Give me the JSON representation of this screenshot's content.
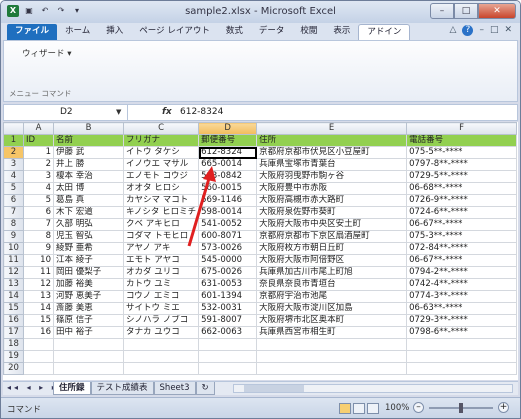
{
  "window": {
    "title": "sample2.xlsx - Microsoft Excel",
    "qat": [
      "▣",
      "↶",
      "↷",
      "▾"
    ],
    "buttons": {
      "minimize": "–",
      "maximize": "□",
      "close": "✕"
    }
  },
  "ribbon": {
    "tabs": [
      "ファイル",
      "ホーム",
      "挿入",
      "ページ レイアウト",
      "数式",
      "データ",
      "校閲",
      "表示",
      "アドイン"
    ],
    "menu": "ウィザード ▾",
    "group_label": "メニュー コマンド",
    "help": [
      "△",
      "?",
      "–",
      "□",
      "✕"
    ]
  },
  "formula_bar": {
    "name_box": "D2",
    "fx": "fx",
    "value": "612-8324"
  },
  "columns": [
    "A",
    "B",
    "C",
    "D",
    "E",
    "F"
  ],
  "header_row": [
    "ID",
    "名前",
    "フリガナ",
    "郵便番号",
    "住所",
    "電話番号"
  ],
  "rows": [
    [
      "1",
      "伊藤 武",
      "イトウ タケシ",
      "612-8324",
      "京都府京都市伏見区小豆屋町",
      "075-5**-****"
    ],
    [
      "2",
      "井上 勝",
      "イノウエ マサル",
      "665-0014",
      "兵庫県宝塚市青葉台",
      "0797-8**-****"
    ],
    [
      "3",
      "榎本 幸治",
      "エノモト コウジ",
      "583-0842",
      "大阪府羽曳野市駒ヶ谷",
      "0729-5**-****"
    ],
    [
      "4",
      "太田 博",
      "オオタ ヒロシ",
      "560-0015",
      "大阪府豊中市赤阪",
      "06-68**-****"
    ],
    [
      "5",
      "葛島 真",
      "カヤシマ マコト",
      "569-1146",
      "大阪府高槻市赤大路町",
      "0726-9**-****"
    ],
    [
      "6",
      "木下 宏道",
      "キノシタ ヒロミチ",
      "598-0014",
      "大阪府泉佐野市葵町",
      "0724-6**-****"
    ],
    [
      "7",
      "久部 明弘",
      "クベ アキヒロ",
      "541-0052",
      "大阪府大阪市中央区安土町",
      "06-67**-****"
    ],
    [
      "8",
      "児玉 智弘",
      "コダマ トモヒロ",
      "600-8071",
      "京都府京都市下京区扇酒屋町",
      "075-3**-****"
    ],
    [
      "9",
      "綾野 亜希",
      "アヤノ アキ",
      "573-0026",
      "大阪府枚方市朝日丘町",
      "072-84**-****"
    ],
    [
      "10",
      "江本 綾子",
      "エモト アヤコ",
      "545-0000",
      "大阪府大阪市阿倍野区",
      "06-67**-****"
    ],
    [
      "11",
      "岡田 優梨子",
      "オカダ ユリコ",
      "675-0026",
      "兵庫県加古川市尾上町旭",
      "0794-2**-****"
    ],
    [
      "12",
      "加藤 裕美",
      "カトウ ユミ",
      "631-0053",
      "奈良県奈良市青垣台",
      "0742-4**-****"
    ],
    [
      "13",
      "河野 恵美子",
      "コウノ エミコ",
      "601-1394",
      "京都府宇治市池尾",
      "0774-3**-****"
    ],
    [
      "14",
      "斎藤 美恵",
      "サイトウ ミエ",
      "532-0031",
      "大阪府大阪市淀川区加島",
      "06-63**-****"
    ],
    [
      "15",
      "篠原 信子",
      "シノハラ ノブコ",
      "591-8007",
      "大阪府堺市北区奥本町",
      "0729-3**-****"
    ],
    [
      "16",
      "田中 裕子",
      "タナカ ユウコ",
      "662-0063",
      "兵庫県西宮市相生町",
      "0798-6**-****"
    ]
  ],
  "row_numbers": [
    "1",
    "2",
    "3",
    "4",
    "5",
    "6",
    "7",
    "8",
    "9",
    "10",
    "11",
    "12",
    "13",
    "14",
    "15",
    "16",
    "17",
    "18",
    "19",
    "20"
  ],
  "sheets": {
    "nav": "◂◂ ◂ ▸ ▸▸",
    "tabs": [
      "住所録",
      "テスト成績表",
      "Sheet3"
    ],
    "add": "↻"
  },
  "status": {
    "mode": "コマンド",
    "zoom": "100%",
    "minus": "–",
    "plus": "+"
  },
  "colors": {
    "header_fill": "#92d050",
    "arrow": "#e02020"
  }
}
